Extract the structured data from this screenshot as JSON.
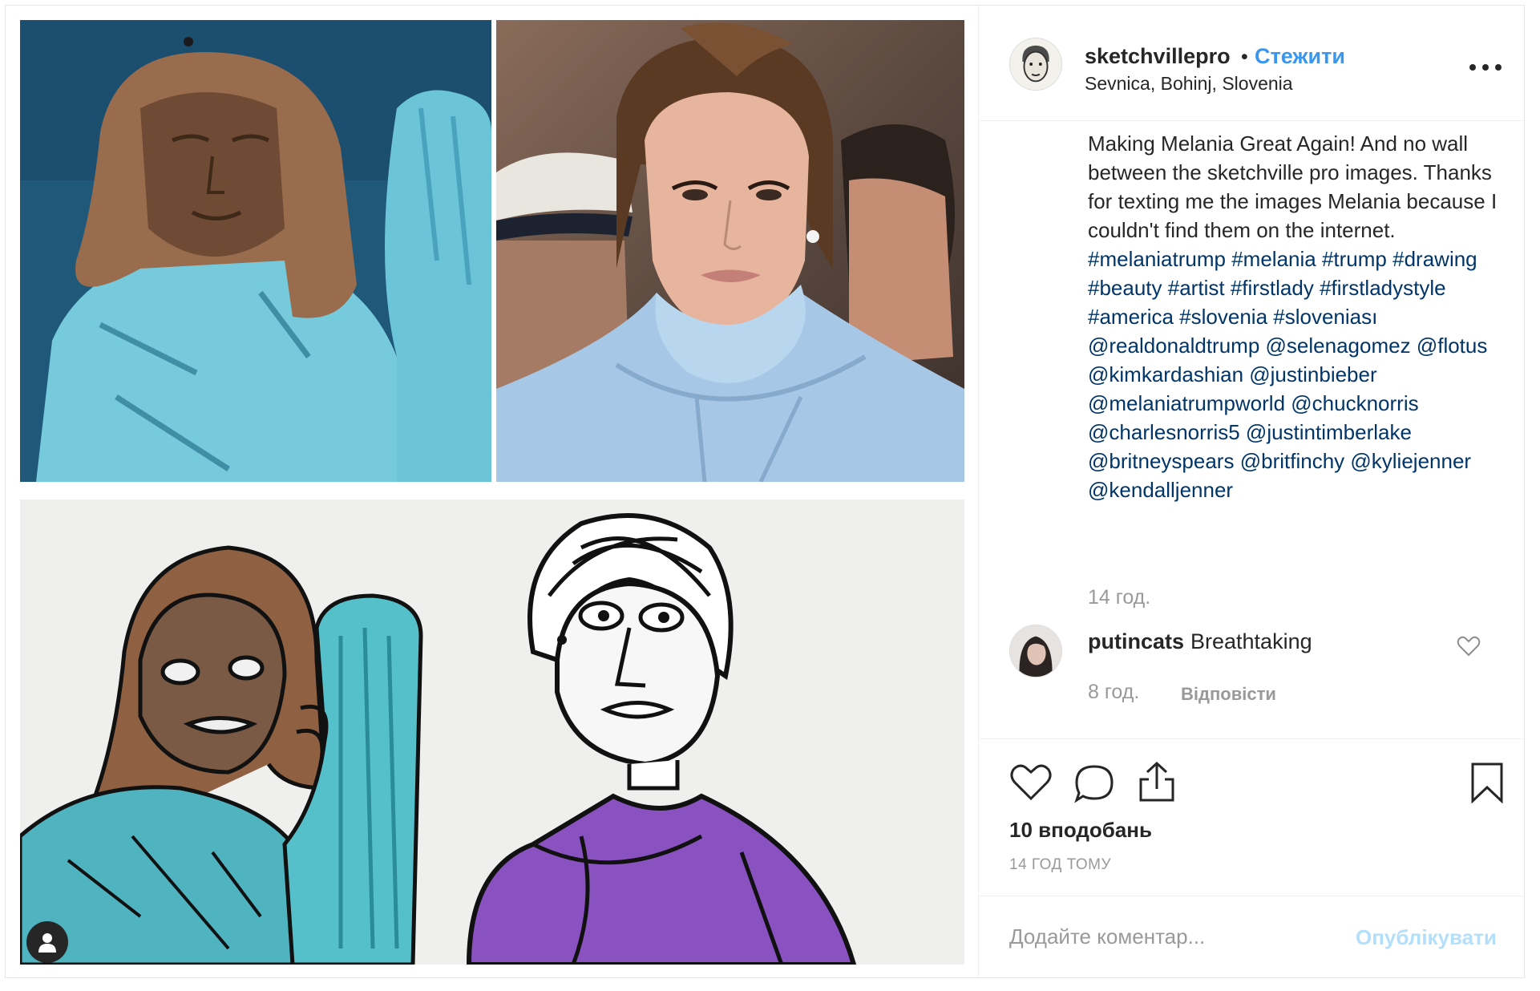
{
  "post": {
    "author": {
      "username": "sketchvillepro",
      "separator": "•",
      "follow_label": "Стежити",
      "location": "Sevnica, Bohinj, Slovenia",
      "avatar_icon": "sketch-portrait-avatar"
    },
    "more_icon": "ellipsis-icon",
    "media": {
      "panels": [
        "wooden-statue-photo",
        "woman-blue-coat-photo",
        "marker-drawing"
      ],
      "tag_icon": "user-silhouette-icon"
    },
    "caption": {
      "text": "Making Melania Great Again! And no wall between the sketchville pro images. Thanks for texting me the images Melania because I couldn't find them on the internet.",
      "hashtags": [
        "#melaniatrump",
        "#melania",
        "#trump",
        "#drawing",
        "#beauty",
        "#artist",
        "#firstlady",
        "#firstladystyle",
        "#america",
        "#slovenia",
        "#sloveniası",
        "@realdonaldtrump",
        "@selenagomez",
        "@flotus",
        "@kimkardashian",
        "@justinbieber",
        "@melaniatrumpworld",
        "@chucknorris",
        "@charlesnorris5",
        "@justintimberlake",
        "@britneyspears",
        "@britfinchy",
        "@kyliejenner",
        "@kendalljenner"
      ],
      "time": "14 год."
    },
    "comments": [
      {
        "username": "putincats",
        "text": "Breathtaking",
        "time": "8 год.",
        "reply_label": "Відповісти"
      }
    ],
    "actions": {
      "like_icon": "heart-icon",
      "comment_icon": "speech-bubble-icon",
      "share_icon": "share-upload-icon",
      "save_icon": "bookmark-icon"
    },
    "likes": "10 вподобань",
    "timestamp": "14 ГОД ТОМУ",
    "add_comment": {
      "placeholder": "Додайте коментар...",
      "publish_label": "Опублікувати"
    },
    "colors": {
      "link": "#3897f0",
      "hashtag": "#003569",
      "muted": "#999999",
      "publish_disabled": "#b2dffc"
    }
  }
}
